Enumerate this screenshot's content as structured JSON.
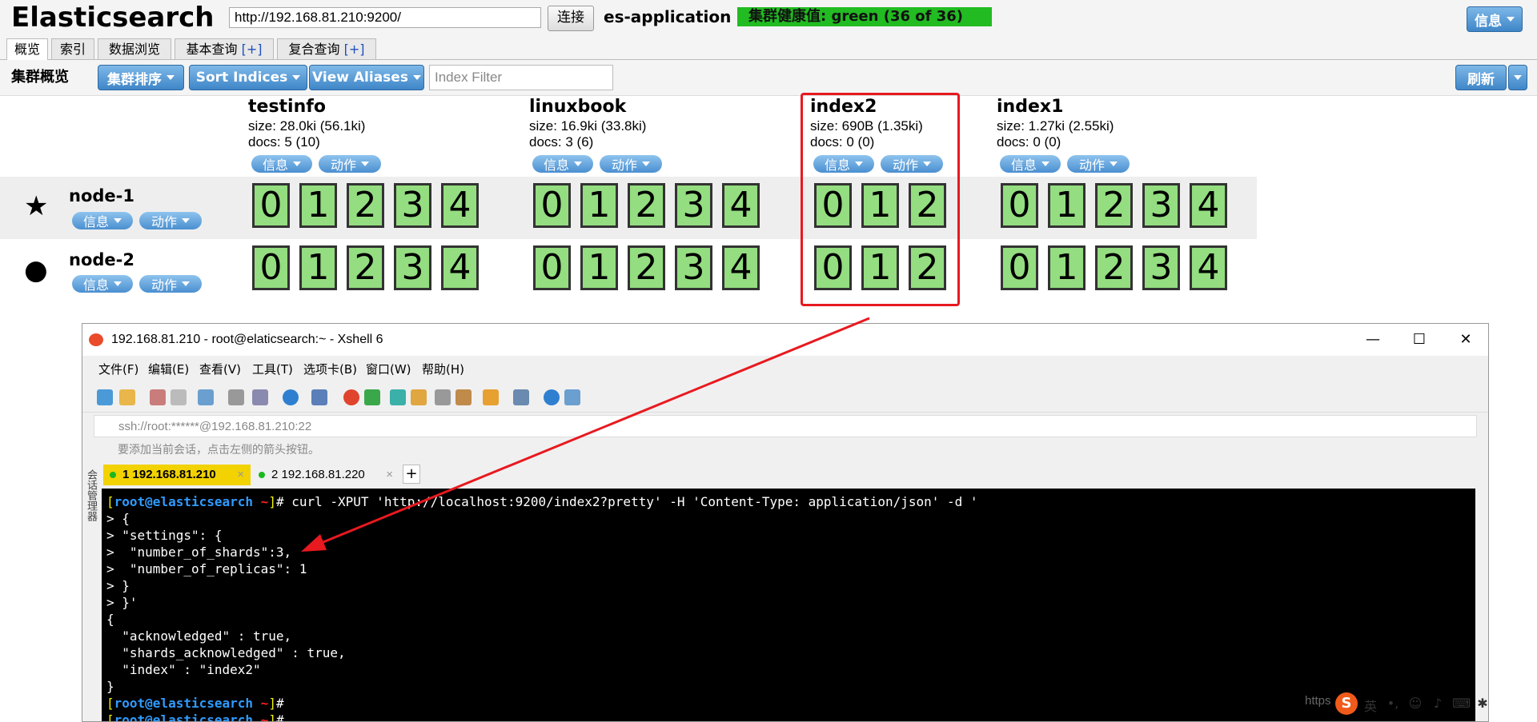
{
  "app": {
    "title": "Elasticsearch",
    "url": "http://192.168.81.210:9200/",
    "connect_label": "连接",
    "cluster_name": "es-application",
    "health": "集群健康值: green (36 of 36)",
    "info_label": "信息"
  },
  "tabs": [
    {
      "label": "概览"
    },
    {
      "label": "索引"
    },
    {
      "label": "数据浏览"
    },
    {
      "label": "基本查询",
      "plus": "[+]"
    },
    {
      "label": "复合查询",
      "plus": "[+]"
    }
  ],
  "toolbar": {
    "section_title": "集群概览",
    "sort_cluster": "集群排序",
    "sort_indices": "Sort Indices",
    "view_aliases": "View Aliases",
    "filter_placeholder": "Index Filter",
    "refresh": "刷新"
  },
  "indices": [
    {
      "name": "testinfo",
      "size": "size: 28.0ki (56.1ki)",
      "docs": "docs: 5 (10)",
      "info": "信息",
      "action": "动作",
      "shards": [
        "0",
        "1",
        "2",
        "3",
        "4"
      ]
    },
    {
      "name": "linuxbook",
      "size": "size: 16.9ki (33.8ki)",
      "docs": "docs: 3 (6)",
      "info": "信息",
      "action": "动作",
      "shards": [
        "0",
        "1",
        "2",
        "3",
        "4"
      ]
    },
    {
      "name": "index2",
      "size": "size: 690B (1.35ki)",
      "docs": "docs: 0 (0)",
      "info": "信息",
      "action": "动作",
      "shards": [
        "0",
        "1",
        "2"
      ]
    },
    {
      "name": "index1",
      "size": "size: 1.27ki (2.55ki)",
      "docs": "docs: 0 (0)",
      "info": "信息",
      "action": "动作",
      "shards": [
        "0",
        "1",
        "2",
        "3",
        "4"
      ]
    }
  ],
  "nodes": [
    {
      "name": "node-1",
      "icon": "★",
      "info": "信息",
      "action": "动作"
    },
    {
      "name": "node-2",
      "icon": "●",
      "info": "信息",
      "action": "动作"
    }
  ],
  "xshell": {
    "title": "192.168.81.210 - root@elaticsearch:~ - Xshell 6",
    "menu": [
      "文件(F)",
      "编辑(E)",
      "查看(V)",
      "工具(T)",
      "选项卡(B)",
      "窗口(W)",
      "帮助(H)"
    ],
    "address": "ssh://root:******@192.168.81.210:22",
    "hint": "要添加当前会话，点击左侧的箭头按钮。",
    "side_label": "会话管理器",
    "tabs": [
      {
        "label": "1 192.168.81.210",
        "active": true
      },
      {
        "label": "2 192.168.81.220",
        "active": false
      }
    ],
    "prompt": {
      "user": "root@elasticsearch",
      "dir": "~"
    },
    "terminal": [
      {
        "prompt": true,
        "text": "# curl -XPUT 'http://localhost:9200/index2?pretty' -H 'Content-Type: application/json' -d '"
      },
      {
        "prompt": false,
        "text": "> {"
      },
      {
        "prompt": false,
        "text": "> \"settings\": {"
      },
      {
        "prompt": false,
        "text": ">  \"number_of_shards\":3,"
      },
      {
        "prompt": false,
        "text": ">  \"number_of_replicas\": 1"
      },
      {
        "prompt": false,
        "text": "> }"
      },
      {
        "prompt": false,
        "text": "> }'"
      },
      {
        "prompt": false,
        "text": "{"
      },
      {
        "prompt": false,
        "text": "  \"acknowledged\" : true,"
      },
      {
        "prompt": false,
        "text": "  \"shards_acknowledged\" : true,"
      },
      {
        "prompt": false,
        "text": "  \"index\" : \"index2\""
      },
      {
        "prompt": false,
        "text": "}"
      },
      {
        "prompt": true,
        "text": "#"
      },
      {
        "prompt": true,
        "text": "#"
      }
    ]
  },
  "ime": {
    "lang": "英",
    "watermark": "https"
  },
  "colors": {
    "shard_green": "#94dd80",
    "health_green": "#22bb22",
    "highlight_red": "#e8191f",
    "button_blue": "#3f86c8"
  }
}
